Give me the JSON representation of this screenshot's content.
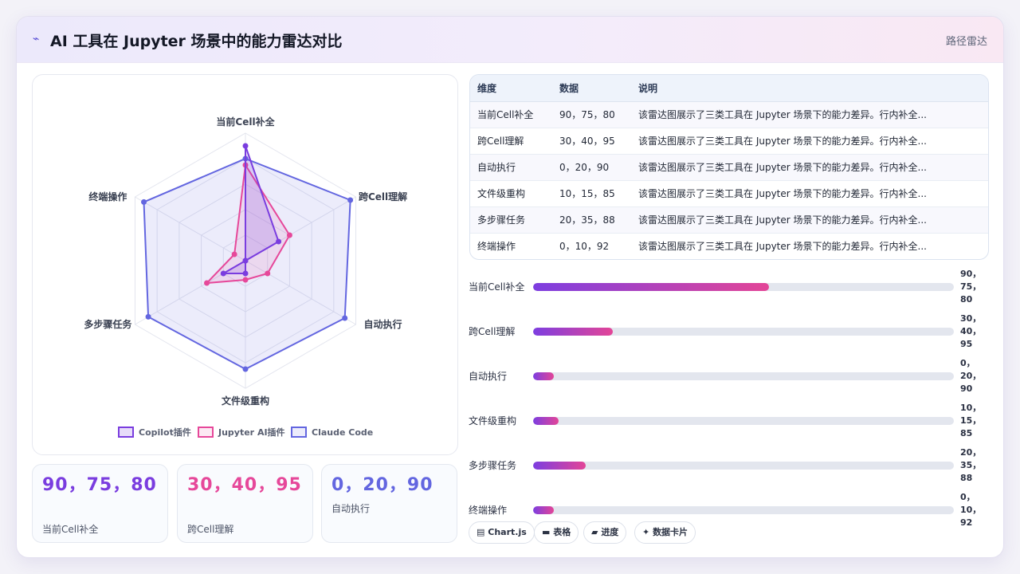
{
  "header": {
    "icon": "trend-icon",
    "title": "AI 工具在 Jupyter 场景中的能力雷达对比",
    "link": "路径雷达"
  },
  "colors": {
    "copilot": "#7a3ddf",
    "jupyter": "#e6489a",
    "claude": "#6366e0"
  },
  "chart_data": {
    "type": "radar",
    "axes": [
      "当前Cell补全",
      "跨Cell理解",
      "自动执行",
      "文件级重构",
      "多步骤任务",
      "终端操作"
    ],
    "range": [
      0,
      100
    ],
    "series": [
      {
        "name": "Copilot插件",
        "values": [
          90,
          30,
          0,
          10,
          20,
          0
        ]
      },
      {
        "name": "Jupyter AI插件",
        "values": [
          75,
          40,
          20,
          15,
          35,
          10
        ]
      },
      {
        "name": "Claude Code",
        "values": [
          80,
          95,
          90,
          85,
          88,
          92
        ]
      }
    ]
  },
  "table": {
    "headers": [
      "维度",
      "数据",
      "说明"
    ],
    "rows": [
      [
        "当前Cell补全",
        "90，75，80",
        "该雷达图展示了三类工具在 Jupyter 场景下的能力差异。行内补全..."
      ],
      [
        "跨Cell理解",
        "30，40，95",
        "该雷达图展示了三类工具在 Jupyter 场景下的能力差异。行内补全..."
      ],
      [
        "自动执行",
        "0，20，90",
        "该雷达图展示了三类工具在 Jupyter 场景下的能力差异。行内补全..."
      ],
      [
        "文件级重构",
        "10，15，85",
        "该雷达图展示了三类工具在 Jupyter 场景下的能力差异。行内补全..."
      ],
      [
        "多步骤任务",
        "20，35，88",
        "该雷达图展示了三类工具在 Jupyter 场景下的能力差异。行内补全..."
      ],
      [
        "终端操作",
        "0，10，92",
        "该雷达图展示了三类工具在 Jupyter 场景下的能力差异。行内补全..."
      ]
    ]
  },
  "bars": [
    {
      "label": "当前Cell补全",
      "value": "90，75，80",
      "fill_percent": 56
    },
    {
      "label": "跨Cell理解",
      "value": "30，40，95",
      "fill_percent": 19
    },
    {
      "label": "自动执行",
      "value": "0，20，90",
      "fill_percent": 5
    },
    {
      "label": "文件级重构",
      "value": "10，15，85",
      "fill_percent": 6
    },
    {
      "label": "多步骤任务",
      "value": "20，35，88",
      "fill_percent": 12.5
    },
    {
      "label": "终端操作",
      "value": "0，10，92",
      "fill_percent": 5
    }
  ],
  "stats": [
    {
      "value": "90，75，80",
      "label": "当前Cell补全",
      "color": "#7a3ddf"
    },
    {
      "value": "30，40，95",
      "label": "跨Cell理解",
      "color": "#e6489a"
    },
    {
      "value": "0，20，90",
      "label": "自动执行",
      "color": "#6366e0"
    }
  ],
  "chips": [
    {
      "icon": "chart-icon",
      "glyph": "▤",
      "label": "Chart.js"
    },
    {
      "icon": "table-icon",
      "glyph": "▬",
      "label": "表格"
    },
    {
      "icon": "progress-icon",
      "glyph": "▰",
      "label": "进度"
    },
    {
      "icon": "sparkle-icon",
      "glyph": "✦",
      "label": "数据卡片"
    }
  ]
}
